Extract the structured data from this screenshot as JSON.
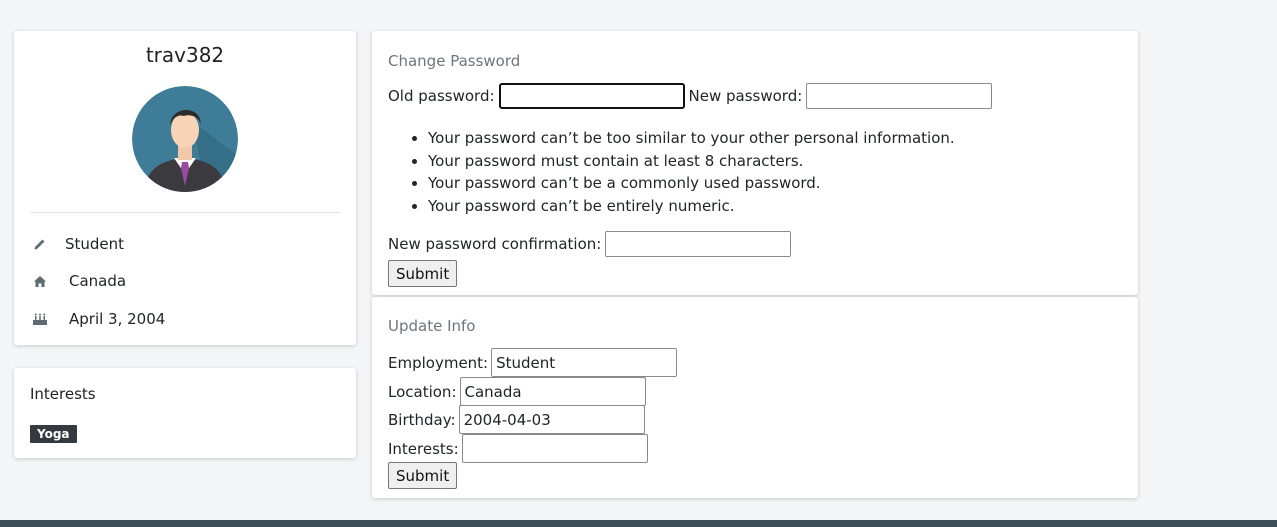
{
  "profile": {
    "username": "trav382",
    "employment": "Student",
    "location": "Canada",
    "birthday": "April 3, 2004",
    "icons": {
      "employment": "pencil-icon",
      "location": "home-icon",
      "birthday": "birthday-cake-icon"
    }
  },
  "interests_card": {
    "title": "Interests",
    "tags": [
      "Yoga"
    ]
  },
  "change_password": {
    "title": "Change Password",
    "old_password_label": "Old password:",
    "old_password_value": "",
    "new_password_label": "New password:",
    "new_password_value": "",
    "rules": [
      "Your password can’t be too similar to your other personal information.",
      "Your password must contain at least 8 characters.",
      "Your password can’t be a commonly used password.",
      "Your password can’t be entirely numeric."
    ],
    "confirmation_label": "New password confirmation:",
    "confirmation_value": "",
    "submit_label": "Submit"
  },
  "update_info": {
    "title": "Update Info",
    "employment_label": "Employment:",
    "employment_value": "Student",
    "location_label": "Location:",
    "location_value": "Canada",
    "birthday_label": "Birthday:",
    "birthday_value": "2004-04-03",
    "interests_label": "Interests:",
    "interests_value": "",
    "submit_label": "Submit"
  },
  "colors": {
    "page_bg": "#f4f5f7",
    "tag_bg": "#343a40",
    "footer": "#3d4d57",
    "muted_title": "#6c757d"
  }
}
